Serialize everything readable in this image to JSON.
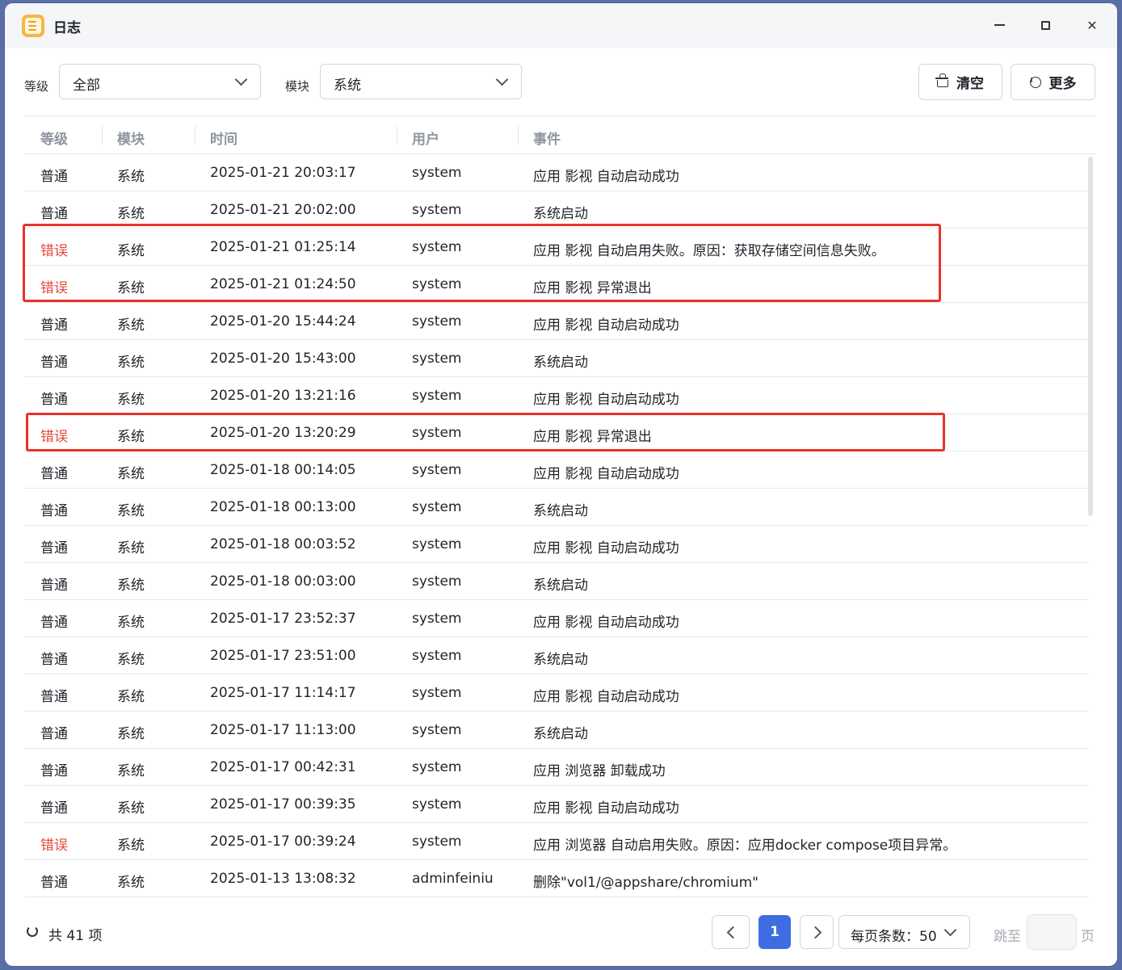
{
  "window": {
    "title": "日志",
    "app_icon": "log-notepad-icon"
  },
  "filters": {
    "level_label": "等级",
    "level_value": "全部",
    "module_label": "模块",
    "module_value": "系统"
  },
  "toolbar": {
    "clear_label": "清空",
    "more_label": "更多"
  },
  "table": {
    "headers": {
      "level": "等级",
      "module": "模块",
      "time": "时间",
      "user": "用户",
      "event": "事件"
    },
    "rows": [
      {
        "level": "普通",
        "module": "系统",
        "time": "2025-01-21 20:03:17",
        "user": "system",
        "event": "应用 影视 自动启动成功"
      },
      {
        "level": "普通",
        "module": "系统",
        "time": "2025-01-21 20:02:00",
        "user": "system",
        "event": "系统启动"
      },
      {
        "level": "错误",
        "module": "系统",
        "time": "2025-01-21 01:25:14",
        "user": "system",
        "event": "应用 影视 自动启用失败。原因：获取存储空间信息失败。"
      },
      {
        "level": "错误",
        "module": "系统",
        "time": "2025-01-21 01:24:50",
        "user": "system",
        "event": "应用 影视 异常退出"
      },
      {
        "level": "普通",
        "module": "系统",
        "time": "2025-01-20 15:44:24",
        "user": "system",
        "event": "应用 影视 自动启动成功"
      },
      {
        "level": "普通",
        "module": "系统",
        "time": "2025-01-20 15:43:00",
        "user": "system",
        "event": "系统启动"
      },
      {
        "level": "普通",
        "module": "系统",
        "time": "2025-01-20 13:21:16",
        "user": "system",
        "event": "应用 影视 自动启动成功"
      },
      {
        "level": "错误",
        "module": "系统",
        "time": "2025-01-20 13:20:29",
        "user": "system",
        "event": "应用 影视 异常退出"
      },
      {
        "level": "普通",
        "module": "系统",
        "time": "2025-01-18 00:14:05",
        "user": "system",
        "event": "应用 影视 自动启动成功"
      },
      {
        "level": "普通",
        "module": "系统",
        "time": "2025-01-18 00:13:00",
        "user": "system",
        "event": "系统启动"
      },
      {
        "level": "普通",
        "module": "系统",
        "time": "2025-01-18 00:03:52",
        "user": "system",
        "event": "应用 影视 自动启动成功"
      },
      {
        "level": "普通",
        "module": "系统",
        "time": "2025-01-18 00:03:00",
        "user": "system",
        "event": "系统启动"
      },
      {
        "level": "普通",
        "module": "系统",
        "time": "2025-01-17 23:52:37",
        "user": "system",
        "event": "应用 影视 自动启动成功"
      },
      {
        "level": "普通",
        "module": "系统",
        "time": "2025-01-17 23:51:00",
        "user": "system",
        "event": "系统启动"
      },
      {
        "level": "普通",
        "module": "系统",
        "time": "2025-01-17 11:14:17",
        "user": "system",
        "event": "应用 影视 自动启动成功"
      },
      {
        "level": "普通",
        "module": "系统",
        "time": "2025-01-17 11:13:00",
        "user": "system",
        "event": "系统启动"
      },
      {
        "level": "普通",
        "module": "系统",
        "time": "2025-01-17 00:42:31",
        "user": "system",
        "event": "应用 浏览器 卸载成功"
      },
      {
        "level": "普通",
        "module": "系统",
        "time": "2025-01-17 00:39:35",
        "user": "system",
        "event": "应用 影视 自动启动成功"
      },
      {
        "level": "错误",
        "module": "系统",
        "time": "2025-01-17 00:39:24",
        "user": "system",
        "event": "应用 浏览器 自动启用失败。原因：应用docker compose项目异常。"
      },
      {
        "level": "普通",
        "module": "系统",
        "time": "2025-01-13 13:08:32",
        "user": "adminfeiniu",
        "event": "删除\"vol1/@appshare/chromium\""
      }
    ]
  },
  "footer": {
    "total": "共 41 项",
    "current_page": "1",
    "page_size": "每页条数：50",
    "jump_prefix": "跳至",
    "jump_suffix": "页",
    "jump_value": ""
  },
  "colors": {
    "error": "#e5473a",
    "accent": "#3d6de0",
    "highlight": "#e8332a"
  }
}
